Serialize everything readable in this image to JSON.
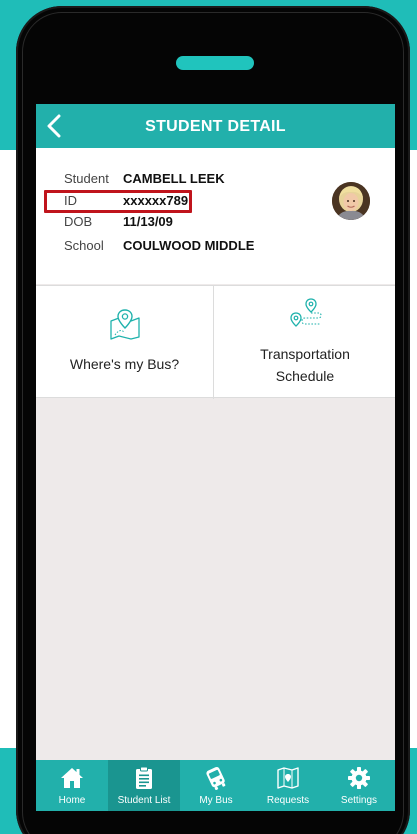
{
  "header": {
    "title": "STUDENT DETAIL"
  },
  "student": {
    "rows": [
      {
        "label": "Student",
        "value": "CAMBELL LEEK"
      },
      {
        "label": "ID",
        "value": "xxxxxx789"
      },
      {
        "label": "DOB",
        "value": "11/13/09"
      },
      {
        "label": "School",
        "value": "COULWOOD MIDDLE"
      }
    ]
  },
  "tiles": [
    {
      "label": "Where's my Bus?",
      "icon": "map-pin-icon"
    },
    {
      "label_line1": "Transportation",
      "label_line2": "Schedule",
      "icon": "route-schedule-icon"
    }
  ],
  "tabbar": {
    "active": "Student List",
    "items": [
      {
        "label": "Home",
        "icon": "home-icon"
      },
      {
        "label": "Student List",
        "icon": "clipboard-icon"
      },
      {
        "label": "My Bus",
        "icon": "bus-icon"
      },
      {
        "label": "Requests",
        "icon": "map-request-icon"
      },
      {
        "label": "Settings",
        "icon": "gear-icon"
      }
    ]
  },
  "colors": {
    "brand": "#22b0ab",
    "brand_dark": "#1a9590",
    "highlight": "#c0141c",
    "background": "#eeeaea"
  }
}
